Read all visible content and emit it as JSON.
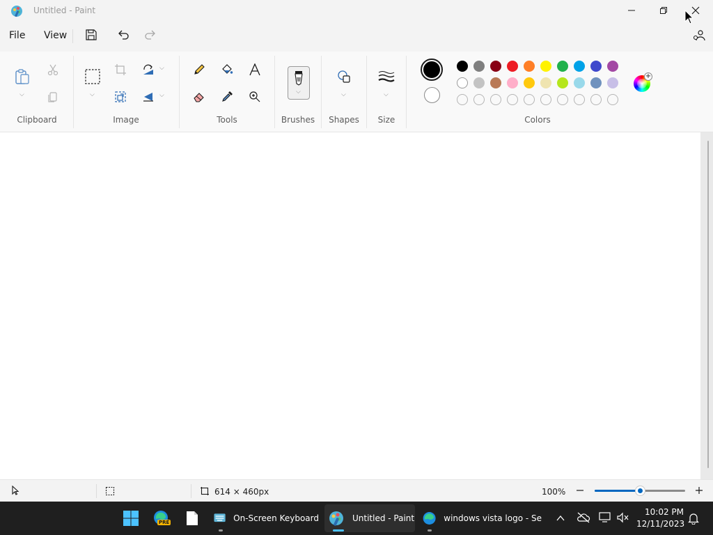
{
  "window": {
    "title": "Untitled - Paint"
  },
  "menu": {
    "file": "File",
    "view": "View"
  },
  "ribbon": {
    "groups": {
      "clipboard": "Clipboard",
      "image": "Image",
      "tools": "Tools",
      "brushes": "Brushes",
      "shapes": "Shapes",
      "size": "Size",
      "colors": "Colors"
    },
    "primary_color": "#000000",
    "secondary_color": "#ffffff",
    "palette_row1": [
      "#000000",
      "#7f7f7f",
      "#880015",
      "#ed1c24",
      "#ff7f27",
      "#fff200",
      "#22b14c",
      "#00a2e8",
      "#3f48cc",
      "#a349a4"
    ],
    "palette_row2": [
      "#ffffff",
      "#c3c3c3",
      "#b97a57",
      "#ffaec9",
      "#ffc90e",
      "#efe4b0",
      "#b5e61d",
      "#99d9ea",
      "#7092be",
      "#c8bfe7"
    ]
  },
  "status": {
    "canvas_size": "614 × 460px",
    "zoom": "100%",
    "zoom_level": 0.5
  },
  "taskbar": {
    "items": [
      {
        "label": "On-Screen Keyboard"
      },
      {
        "label": "Untitled - Paint"
      },
      {
        "label": "windows vista logo - Se"
      }
    ],
    "edge_badge": "PRE",
    "time": "10:02 PM",
    "date": "12/11/2023"
  }
}
